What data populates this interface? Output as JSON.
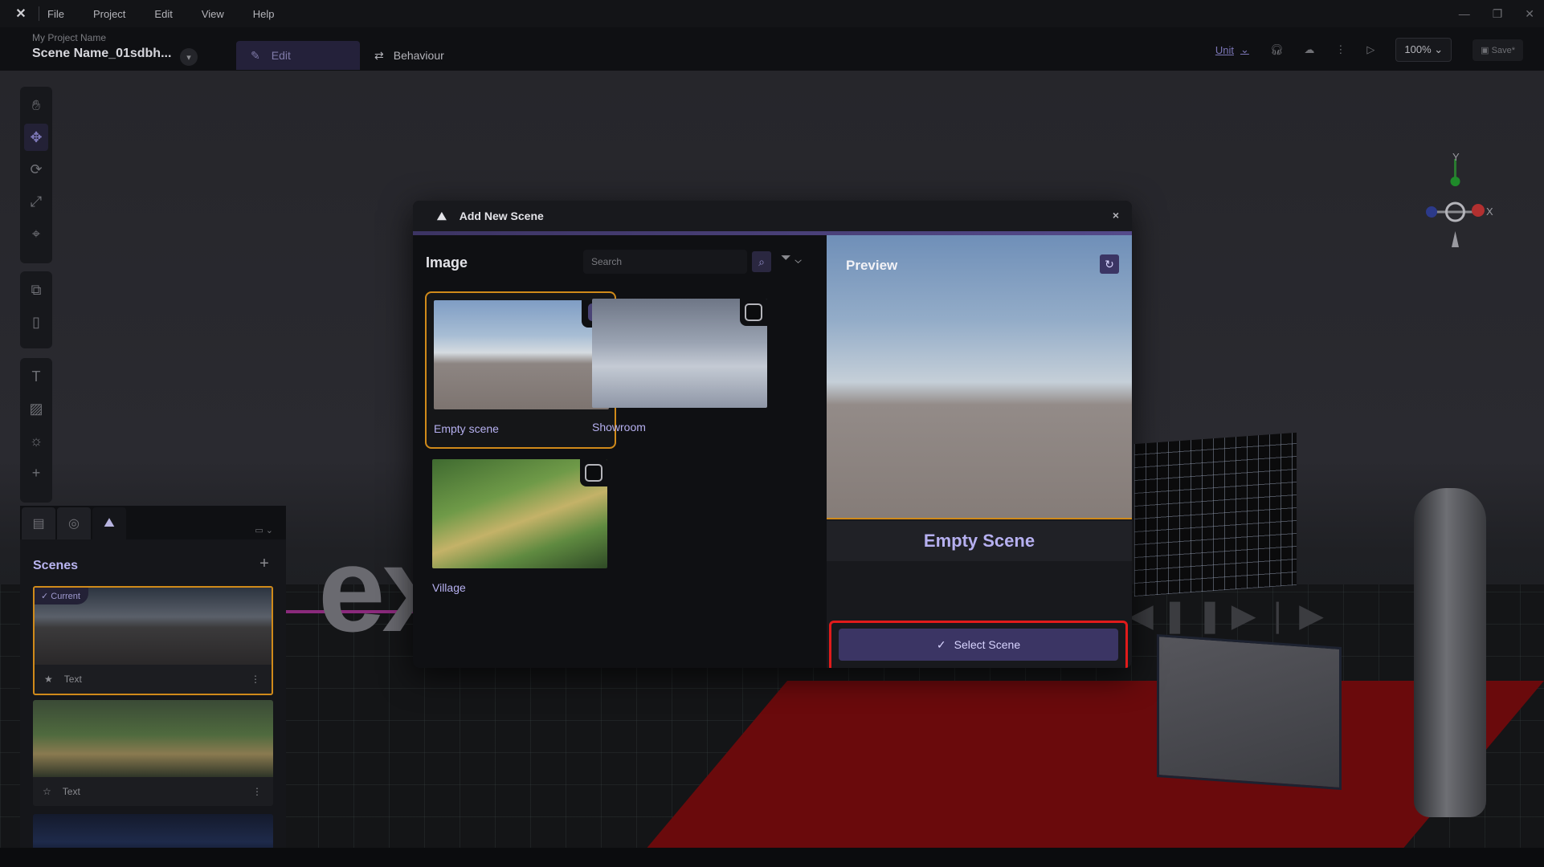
{
  "menubar": {
    "items": [
      "File",
      "Project",
      "Edit",
      "View",
      "Help"
    ]
  },
  "titlebar": {
    "project_name": "My Project Name",
    "scene_name": "Scene Name_01sdbh...",
    "tabs": [
      {
        "label": "Edit",
        "active": true
      },
      {
        "label": "Behaviour",
        "active": false
      }
    ],
    "unit_label": "Unit",
    "zoom": "100%",
    "save_label": "Save*"
  },
  "scenes_panel": {
    "title": "Scenes",
    "current_badge": "Current",
    "items": [
      {
        "label": "Text",
        "current": true
      },
      {
        "label": "Text",
        "current": false
      }
    ]
  },
  "viewport": {
    "background_text": "ex",
    "axis_x": "X",
    "axis_y": "Y"
  },
  "modal": {
    "title": "Add New Scene",
    "close_glyph": "×",
    "category_label": "Image",
    "search_placeholder": "Search",
    "tiles": [
      {
        "name": "Empty scene",
        "selected": true
      },
      {
        "name": "Showroom",
        "selected": false
      },
      {
        "name": "Village",
        "selected": false
      }
    ],
    "preview": {
      "label": "Preview",
      "scene_title": "Empty Scene",
      "select_button": "Select Scene"
    }
  },
  "colors": {
    "accent_purple": "#3b3564",
    "highlight_orange": "#d08a1a",
    "annotation_red": "#e11b1b",
    "text_lavender": "#b6b0f0"
  }
}
